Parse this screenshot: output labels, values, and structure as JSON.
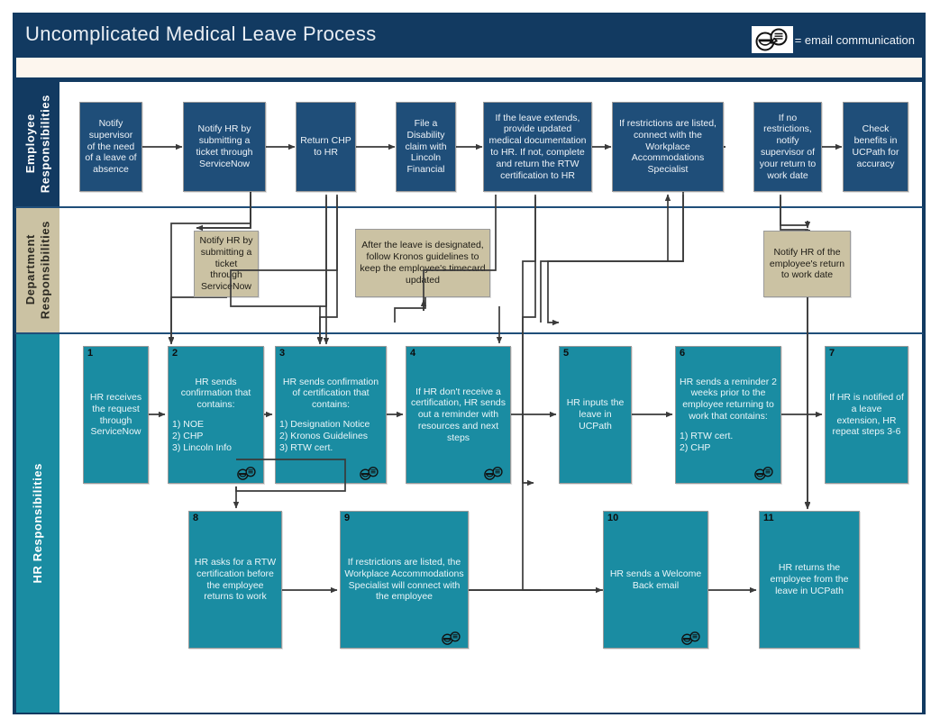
{
  "header": {
    "title": "Uncomplicated Medical Leave Process",
    "legend_label": "= email communication",
    "legend_icon": "email-communication-icon"
  },
  "colors": {
    "header_navy": "#123a61",
    "employee_box": "#1f4e79",
    "department_box": "#cbc2a3",
    "hr_box": "#1a8ca2",
    "cream_bar": "#fdf6ee",
    "connector": "#3a3a3a"
  },
  "lanes": [
    {
      "id": "employee",
      "label": "Employee\nResponsibilities"
    },
    {
      "id": "department",
      "label": "Department\nResponsibilities"
    },
    {
      "id": "hr",
      "label": "HR Responsibilities"
    }
  ],
  "employee_steps": [
    {
      "text": "Notify supervisor of the need of a leave of absence"
    },
    {
      "text": "Notify HR by submitting a ticket through ServiceNow"
    },
    {
      "text": "Return CHP to HR"
    },
    {
      "text": "File a Disability claim with Lincoln Financial"
    },
    {
      "text": "If the leave extends, provide updated medical documentation to HR. If not, complete and return the RTW certification to HR"
    },
    {
      "text": "If restrictions are listed, connect with the Workplace Accommodations Specialist"
    },
    {
      "text": "If no restrictions, notify supervisor of your return to work date"
    },
    {
      "text": "Check benefits in UCPath for accuracy"
    }
  ],
  "department_steps": [
    {
      "text": "Notify HR by submitting a ticket through ServiceNow"
    },
    {
      "text": "After the leave is designated, follow Kronos guidelines to keep the employee's timecard updated"
    },
    {
      "text": "Notify HR of the employee's return to work date"
    }
  ],
  "hr_steps": [
    {
      "number": "1",
      "lead": "HR receives the request through ServiceNow",
      "list": "",
      "email": false
    },
    {
      "number": "2",
      "lead": "HR sends confirmation that contains:",
      "list": "1) NOE\n2) CHP\n3) Lincoln Info",
      "email": true
    },
    {
      "number": "3",
      "lead": "HR sends confirmation of certification that contains:",
      "list": "1) Designation Notice\n2) Kronos Guidelines\n3) RTW cert.",
      "email": true
    },
    {
      "number": "4",
      "lead": "If HR don't receive a certification, HR sends out a reminder with resources and next steps",
      "list": "",
      "email": true
    },
    {
      "number": "5",
      "lead": "HR inputs the leave in UCPath",
      "list": "",
      "email": false
    },
    {
      "number": "6",
      "lead": "HR sends a reminder 2 weeks prior to the employee returning to work that contains:",
      "list": "1) RTW cert.\n2) CHP",
      "email": true
    },
    {
      "number": "7",
      "lead": "If HR is notified of a leave extension, HR repeat steps 3-6",
      "list": "",
      "email": false
    },
    {
      "number": "8",
      "lead": "HR asks for a RTW certification before the employee returns to work",
      "list": "",
      "email": false
    },
    {
      "number": "9",
      "lead": "If restrictions are listed, the Workplace Accommodations Specialist will connect with the employee",
      "list": "",
      "email": true
    },
    {
      "number": "10",
      "lead": "HR sends a Welcome Back email",
      "list": "",
      "email": true
    },
    {
      "number": "11",
      "lead": "HR returns the employee from the leave in UCPath",
      "list": "",
      "email": false
    }
  ]
}
